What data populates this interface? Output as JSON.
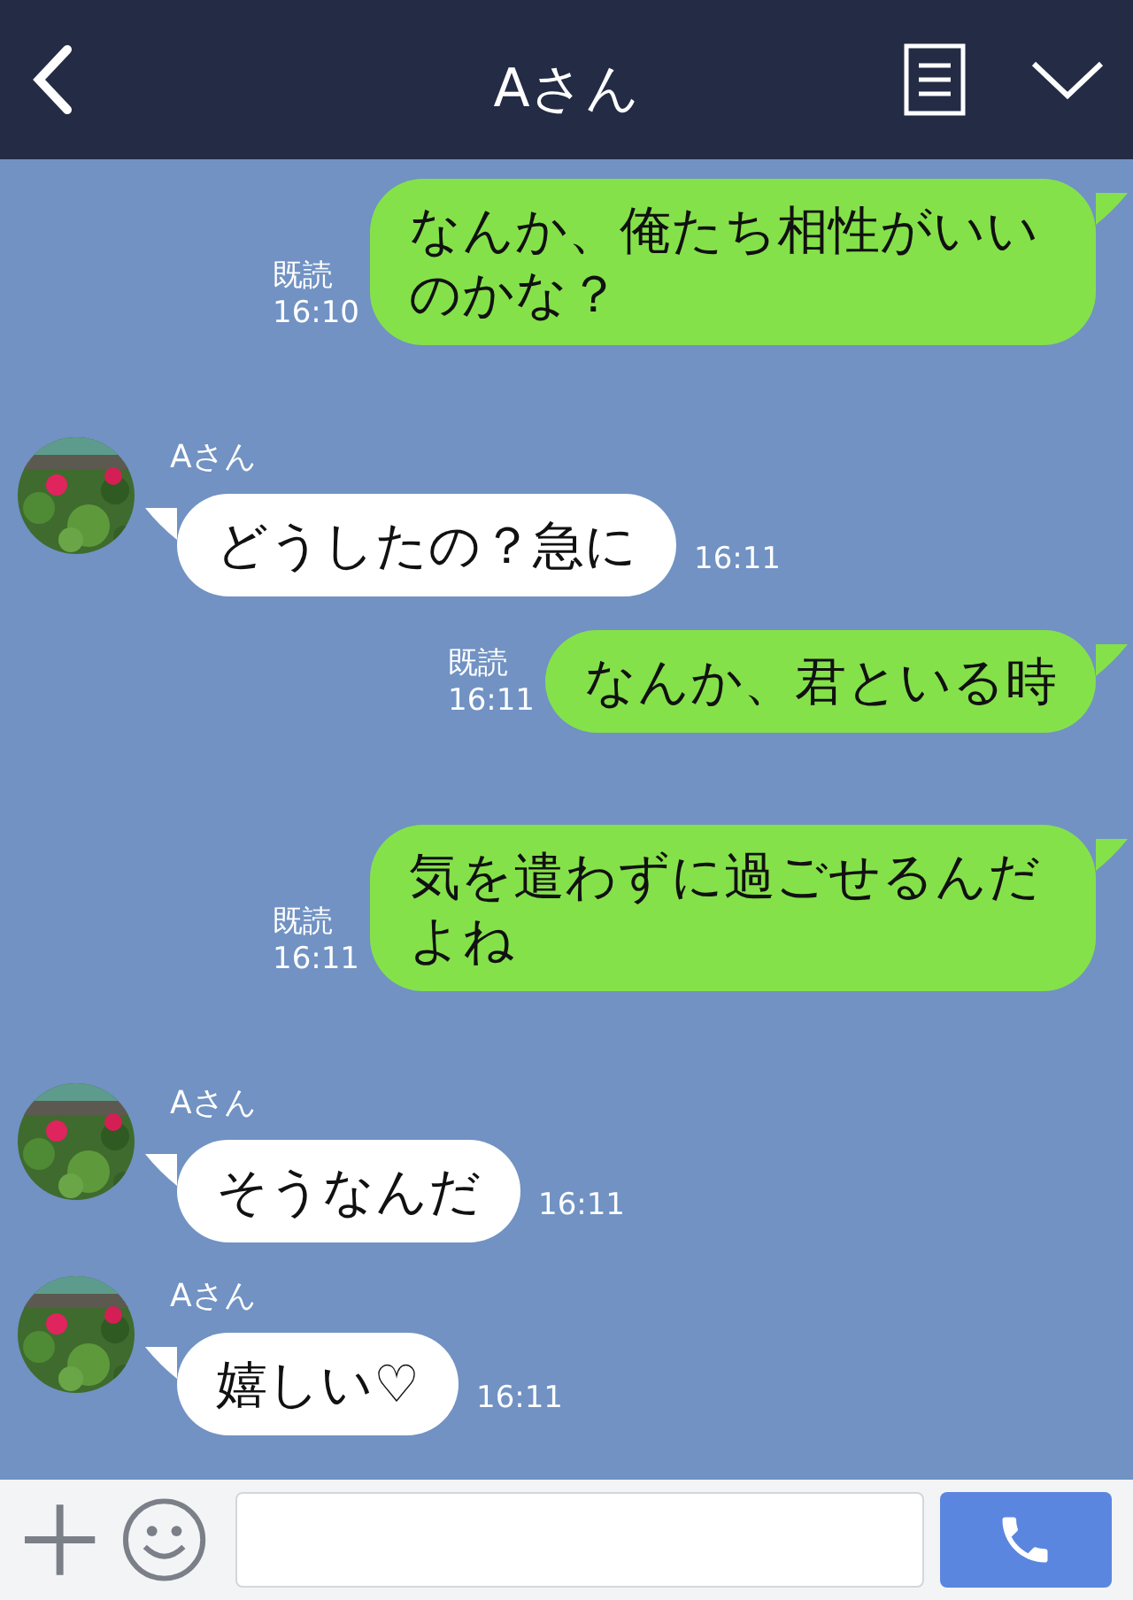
{
  "header": {
    "title": "Aさん"
  },
  "messages": [
    {
      "kind": "sent",
      "text": "なんか、俺たち相性がいいのかな？",
      "read": "既読",
      "time": "16:10"
    },
    {
      "kind": "received",
      "name": "Aさん",
      "text": "どうしたの？急に",
      "time": "16:11"
    },
    {
      "kind": "sent",
      "text": "なんか、君といる時",
      "read": "既読",
      "time": "16:11"
    },
    {
      "kind": "sent",
      "text": "気を遣わずに過ごせるんだよね",
      "read": "既読",
      "time": "16:11"
    },
    {
      "kind": "received",
      "name": "Aさん",
      "text": "そうなんだ",
      "time": "16:11"
    },
    {
      "kind": "received",
      "name": "Aさん",
      "text": "嬉しい♡",
      "time": "16:11"
    }
  ]
}
